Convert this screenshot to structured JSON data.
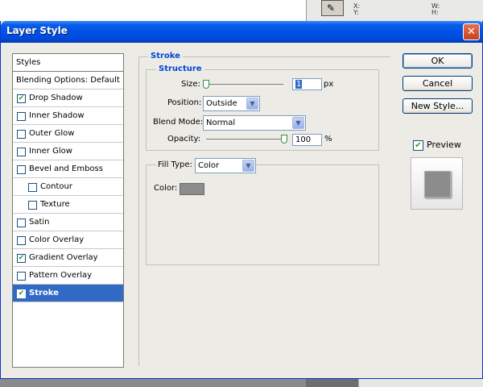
{
  "background": {
    "xy_label": "X:\nY:",
    "wh_label": "W:\nH:"
  },
  "dialog": {
    "title": "Layer Style",
    "close_icon": "✕"
  },
  "styles_list": {
    "items": [
      {
        "label": "Styles",
        "checkbox": false,
        "checked": false,
        "indent": false,
        "selected": false
      },
      {
        "label": "Blending Options: Default",
        "checkbox": false,
        "checked": false,
        "indent": false,
        "selected": false
      },
      {
        "label": "Drop Shadow",
        "checkbox": true,
        "checked": true,
        "indent": false,
        "selected": false
      },
      {
        "label": "Inner Shadow",
        "checkbox": true,
        "checked": false,
        "indent": false,
        "selected": false
      },
      {
        "label": "Outer Glow",
        "checkbox": true,
        "checked": false,
        "indent": false,
        "selected": false
      },
      {
        "label": "Inner Glow",
        "checkbox": true,
        "checked": false,
        "indent": false,
        "selected": false
      },
      {
        "label": "Bevel and Emboss",
        "checkbox": true,
        "checked": false,
        "indent": false,
        "selected": false
      },
      {
        "label": "Contour",
        "checkbox": true,
        "checked": false,
        "indent": true,
        "selected": false
      },
      {
        "label": "Texture",
        "checkbox": true,
        "checked": false,
        "indent": true,
        "selected": false
      },
      {
        "label": "Satin",
        "checkbox": true,
        "checked": false,
        "indent": false,
        "selected": false
      },
      {
        "label": "Color Overlay",
        "checkbox": true,
        "checked": false,
        "indent": false,
        "selected": false
      },
      {
        "label": "Gradient Overlay",
        "checkbox": true,
        "checked": true,
        "indent": false,
        "selected": false
      },
      {
        "label": "Pattern Overlay",
        "checkbox": true,
        "checked": false,
        "indent": false,
        "selected": false
      },
      {
        "label": "Stroke",
        "checkbox": true,
        "checked": true,
        "indent": false,
        "selected": true
      }
    ]
  },
  "stroke": {
    "section_title": "Stroke",
    "structure_title": "Structure",
    "size_label": "Size:",
    "size_value": "1",
    "size_unit": "px",
    "position_label": "Position:",
    "position_value": "Outside",
    "blend_mode_label": "Blend Mode:",
    "blend_mode_value": "Normal",
    "opacity_label": "Opacity:",
    "opacity_value": "100",
    "opacity_unit": "%",
    "fill_type_label": "Fill Type:",
    "fill_type_value": "Color",
    "color_label": "Color:",
    "color_value": "#8c8c8c"
  },
  "buttons": {
    "ok": "OK",
    "cancel": "Cancel",
    "new_style": "New Style...",
    "preview_label": "Preview",
    "preview_checked": true
  },
  "colors": {
    "selection": "#316ac5",
    "title_accent": "#0046d5",
    "check": "#21a121"
  }
}
